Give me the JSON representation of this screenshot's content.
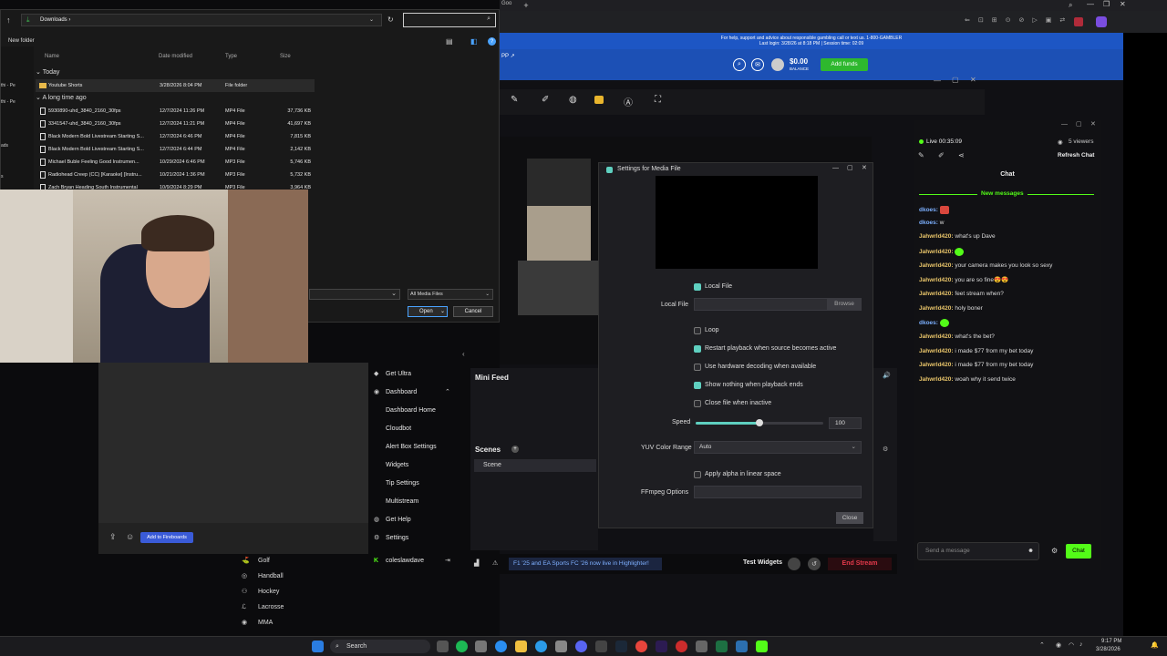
{
  "file_dialog": {
    "path": "Downloads",
    "new_folder": "New folder",
    "columns": {
      "name": "Name",
      "date": "Date modified",
      "type": "Type",
      "size": "Size"
    },
    "group_today": "Today",
    "group_long": "A long time ago",
    "rows": [
      {
        "name": "Youtube Shorts",
        "date": "3/28/2026 8:04 PM",
        "type": "File folder",
        "size": ""
      },
      {
        "name": "5930890-uhd_3840_2160_30fps",
        "date": "12/7/2024 11:26 PM",
        "type": "MP4 File",
        "size": "37,736 KB"
      },
      {
        "name": "3341547-uhd_3840_2160_30fps",
        "date": "12/7/2024 11:21 PM",
        "type": "MP4 File",
        "size": "41,697 KB"
      },
      {
        "name": "Black Modern Bold Livestream Starting S...",
        "date": "12/7/2024 6:46 PM",
        "type": "MP4 File",
        "size": "7,815 KB"
      },
      {
        "name": "Black Modern Bold Livestream Starting S...",
        "date": "12/7/2024 6:44 PM",
        "type": "MP4 File",
        "size": "2,142 KB"
      },
      {
        "name": "Michael Buble    Feeling Good Instrumen...",
        "date": "10/29/2024 6:46 PM",
        "type": "MP3 File",
        "size": "5,746 KB"
      },
      {
        "name": "Radiohead  Creep (CC) [Karaoke] [Instru...",
        "date": "10/21/2024 1:36 PM",
        "type": "MP3 File",
        "size": "5,732 KB"
      },
      {
        "name": "Zach Bryan Heading South Instrumental",
        "date": "10/9/2024 8:29 PM",
        "type": "MP3 File",
        "size": "3,964 KB"
      }
    ],
    "left_items": [
      "thi - Pe",
      "thi - Pe",
      "ads",
      "s"
    ],
    "filter": "All Media Files",
    "open": "Open",
    "cancel": "Cancel"
  },
  "browser": {
    "banner_line1": "For help, support and advice about responsible gambling call or text us. 1-800-GAMBLER",
    "banner_line2": "Last login: 3/28/26 at 8:18 PM | Session time: 02:09",
    "balance": "$0.00",
    "balance_label": "BALANCE",
    "add_funds": "Add funds",
    "tab_partial": "Goo"
  },
  "streamlabs": {
    "nav": [
      "Get Ultra",
      "Dashboard",
      "Dashboard Home",
      "Cloudbot",
      "Alert Box Settings",
      "Widgets",
      "Tip Settings",
      "Multistream",
      "Get Help",
      "Settings"
    ],
    "user": "coleslawdave",
    "add_to_fireboards": "Add to Fireboards",
    "mini_feed": "Mini Feed",
    "scenes": "Scenes",
    "scene_item": "Scene",
    "ticker": "F1 '25 and EA Sports FC '26 now live in Highlighter!",
    "test_widgets": "Test Widgets",
    "end_stream": "End Stream",
    "sports": [
      "Golf",
      "Handball",
      "Hockey",
      "Lacrosse",
      "MMA"
    ]
  },
  "media_settings": {
    "title": "Settings for Media File",
    "local_file_check": "Local File",
    "local_file_label": "Local File",
    "browse": "Browse",
    "loop": "Loop",
    "restart": "Restart playback when source becomes active",
    "hw_decode": "Use hardware decoding when available",
    "show_nothing": "Show nothing when playback ends",
    "close_inactive": "Close file when inactive",
    "speed_label": "Speed",
    "speed_value": "100",
    "speed_level": 0.5,
    "yuv_label": "YUV Color Range",
    "yuv_value": "Auto",
    "alpha": "Apply alpha in linear space",
    "ffmpeg_label": "FFmpeg Options",
    "close": "Close"
  },
  "chat": {
    "live": "Live 00:35:09",
    "viewers": "5 viewers",
    "refresh": "Refresh Chat",
    "title": "Chat",
    "new_messages": "New messages",
    "messages": [
      {
        "user": "dkoes:",
        "text": ""
      },
      {
        "user": "dkoes:",
        "text": "w"
      },
      {
        "user": "Jahwrld420:",
        "text": "what's up Dave"
      },
      {
        "user": "Jahwrld420:",
        "text": ""
      },
      {
        "user": "Jahwrld420:",
        "text": "your camera makes you look so sexy"
      },
      {
        "user": "Jahwrld420:",
        "text": "you are so fine😍😍"
      },
      {
        "user": "Jahwrld420:",
        "text": "feet stream when?"
      },
      {
        "user": "Jahwrld420:",
        "text": "holy boner"
      },
      {
        "user": "dkoes:",
        "text": ""
      },
      {
        "user": "Jahwrld420:",
        "text": "what's the bet?"
      },
      {
        "user": "Jahwrld420:",
        "text": "i made $77 from my bet today"
      },
      {
        "user": "Jahwrld420:",
        "text": "i made $77 from my bet today"
      },
      {
        "user": "Jahwrld420:",
        "text": "woah why it send twice"
      }
    ],
    "placeholder": "Send a message",
    "send": "Chat"
  },
  "taskbar": {
    "search": "Search",
    "time": "9:17 PM",
    "date": "3/28/2026"
  },
  "colors": {
    "accent": "#53fc18",
    "obs_check": "#5fd0c0",
    "brand_blue": "#1d56c4",
    "end_stream": "#e3394b"
  }
}
